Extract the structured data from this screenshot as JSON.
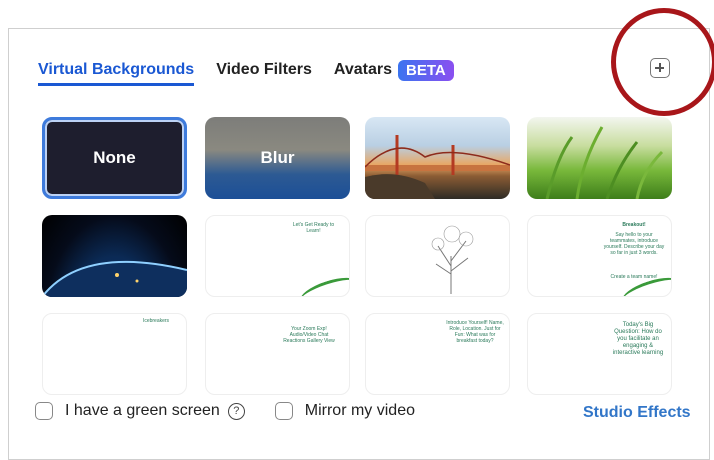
{
  "tabs": [
    {
      "label": "Virtual Backgrounds",
      "active": true
    },
    {
      "label": "Video Filters",
      "active": false
    },
    {
      "label": "Avatars",
      "active": false
    }
  ],
  "beta_badge": "BETA",
  "add_button_icon": "plus-square-icon",
  "highlight_color": "#a8161a",
  "accent_color": "#1a58d3",
  "backgrounds": {
    "none_label": "None",
    "blur_label": "Blur",
    "doc1_text": "Let's Get Ready to Learn!",
    "doc3_title": "Breakout!",
    "doc3_text": "Say hello to your teammates, introduce yourself. Describe your day so far in just 3 words.",
    "doc3_footer": "Create a team name!",
    "doc4_title": "Icebreakers",
    "doc5_text": "Your Zoom Exp! Audio/Video Chat Reactions Gallery View",
    "doc6_text": "Introduce Yourself! Name, Role, Location. Just for Fun: What was for breakfast today?",
    "doc7_text": "Today's Big Question: How do you facilitate an engaging & interactive learning"
  },
  "footer": {
    "green_screen_label": "I have a green screen",
    "mirror_label": "Mirror my video",
    "studio_effects_label": "Studio Effects"
  }
}
